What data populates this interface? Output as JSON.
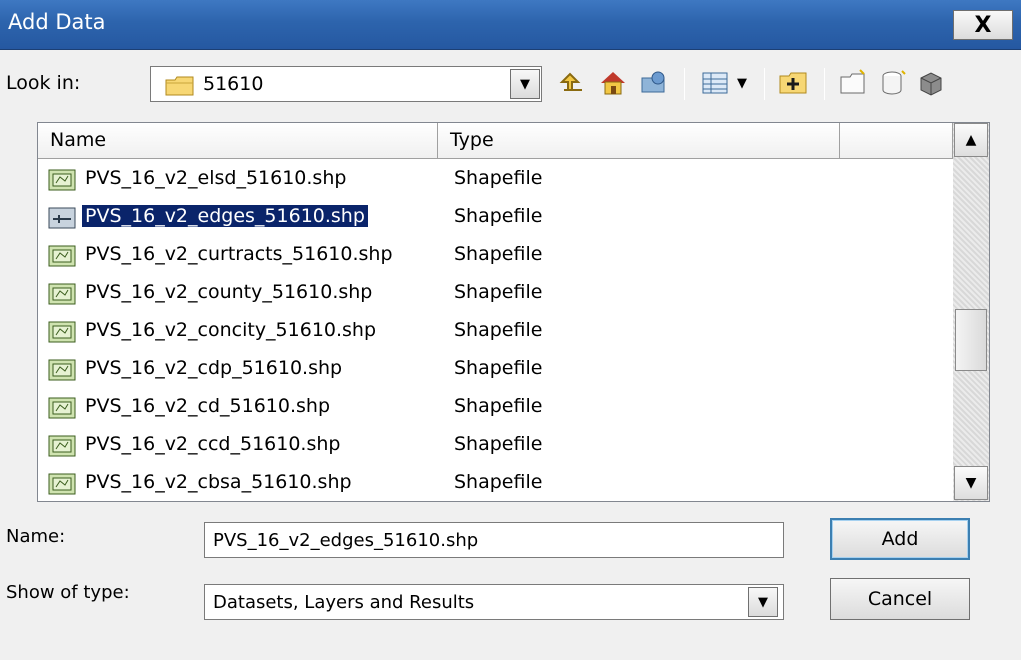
{
  "window": {
    "title": "Add Data",
    "close_label": "X"
  },
  "look_in": {
    "label": "Look in:",
    "value": "51610"
  },
  "columns": [
    "Name",
    "Type"
  ],
  "files": [
    {
      "name": "PVS_16_v2_elsd_51610.shp",
      "type": "Shapefile",
      "icon": "polygon-shapefile-icon",
      "selected": false
    },
    {
      "name": "PVS_16_v2_edges_51610.shp",
      "type": "Shapefile",
      "icon": "line-shapefile-icon",
      "selected": true
    },
    {
      "name": "PVS_16_v2_curtracts_51610.shp",
      "type": "Shapefile",
      "icon": "polygon-shapefile-icon",
      "selected": false
    },
    {
      "name": "PVS_16_v2_county_51610.shp",
      "type": "Shapefile",
      "icon": "polygon-shapefile-icon",
      "selected": false
    },
    {
      "name": "PVS_16_v2_concity_51610.shp",
      "type": "Shapefile",
      "icon": "polygon-shapefile-icon",
      "selected": false
    },
    {
      "name": "PVS_16_v2_cdp_51610.shp",
      "type": "Shapefile",
      "icon": "polygon-shapefile-icon",
      "selected": false
    },
    {
      "name": "PVS_16_v2_cd_51610.shp",
      "type": "Shapefile",
      "icon": "polygon-shapefile-icon",
      "selected": false
    },
    {
      "name": "PVS_16_v2_ccd_51610.shp",
      "type": "Shapefile",
      "icon": "polygon-shapefile-icon",
      "selected": false
    },
    {
      "name": "PVS_16_v2_cbsa_51610.shp",
      "type": "Shapefile",
      "icon": "polygon-shapefile-icon",
      "selected": false
    }
  ],
  "name_field": {
    "label": "Name:",
    "value": "PVS_16_v2_edges_51610.shp"
  },
  "type_field": {
    "label": "Show of type:",
    "value": "Datasets, Layers and Results"
  },
  "buttons": {
    "add": "Add",
    "cancel": "Cancel"
  },
  "toolbar_icons": [
    "up-one-level-icon",
    "home-icon",
    "connect-folder-icon",
    "view-menu-icon",
    "add-folder-connection-icon",
    "new-folder-icon",
    "new-geodatabase-icon",
    "options-icon"
  ]
}
